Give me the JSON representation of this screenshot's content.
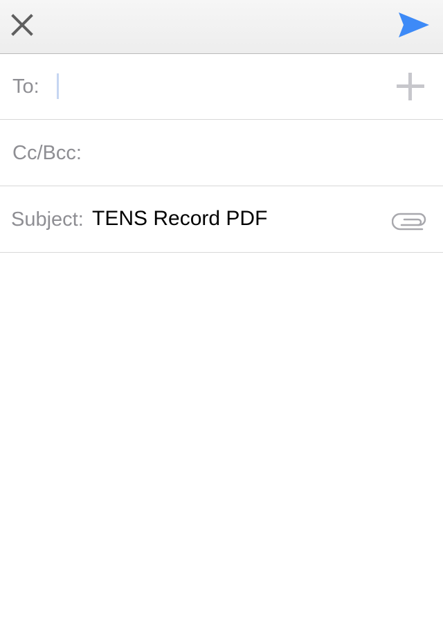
{
  "toolbar": {
    "close_icon": "close-icon",
    "send_icon": "send-icon",
    "send_color": "#3d8af7"
  },
  "to": {
    "label": "To:",
    "value": "",
    "add_icon": "plus-icon"
  },
  "cc_bcc": {
    "label": "Cc/Bcc:",
    "value": ""
  },
  "subject": {
    "label": "Subject:",
    "value": "TENS Record PDF",
    "attach_icon": "paperclip-icon"
  },
  "body": {
    "text": ""
  }
}
